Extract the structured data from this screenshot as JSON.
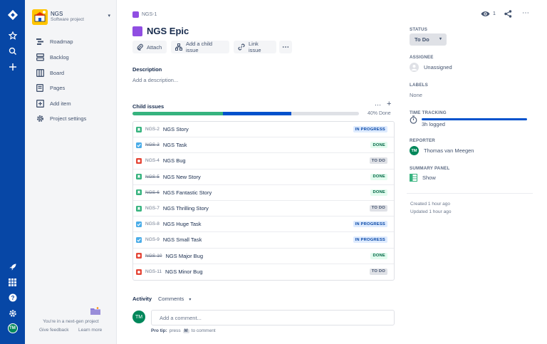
{
  "project": {
    "name": "NGS",
    "type": "Software project"
  },
  "sidebar": {
    "items": [
      {
        "label": "Roadmap",
        "icon": "roadmap-icon"
      },
      {
        "label": "Backlog",
        "icon": "backlog-icon"
      },
      {
        "label": "Board",
        "icon": "board-icon"
      },
      {
        "label": "Pages",
        "icon": "pages-icon"
      },
      {
        "label": "Add item",
        "icon": "add-item-icon"
      },
      {
        "label": "Project settings",
        "icon": "gear-icon"
      }
    ],
    "footer_text": "You're in a next-gen project",
    "give_feedback": "Give feedback",
    "learn_more": "Learn more"
  },
  "global_nav": {
    "user_initials": "TM"
  },
  "issue": {
    "breadcrumb_key": "NGS-1",
    "title": "NGS Epic",
    "watch_count": "1",
    "buttons": {
      "attach": "Attach",
      "add_child": "Add a child issue",
      "link": "Link issue"
    }
  },
  "description": {
    "label": "Description",
    "placeholder": "Add a description..."
  },
  "child_issues": {
    "label": "Child issues",
    "done_fraction": 0.4,
    "in_progress_fraction": 0.3,
    "percent_label": "40% Done",
    "items": [
      {
        "key": "NGS-2",
        "summary": "NGS Story",
        "type": "story",
        "status": "IN PROGRESS",
        "status_kind": "inprog",
        "resolved": false
      },
      {
        "key": "NGS-3",
        "summary": "NGS Task",
        "type": "task",
        "status": "DONE",
        "status_kind": "done",
        "resolved": true
      },
      {
        "key": "NGS-4",
        "summary": "NGS Bug",
        "type": "bug",
        "status": "TO DO",
        "status_kind": "todo",
        "resolved": false
      },
      {
        "key": "NGS-5",
        "summary": "NGS New Story",
        "type": "story",
        "status": "DONE",
        "status_kind": "done",
        "resolved": true
      },
      {
        "key": "NGS-6",
        "summary": "NGS Fantastic Story",
        "type": "story",
        "status": "DONE",
        "status_kind": "done",
        "resolved": true
      },
      {
        "key": "NGS-7",
        "summary": "NGS Thrilling Story",
        "type": "story",
        "status": "TO DO",
        "status_kind": "todo",
        "resolved": false
      },
      {
        "key": "NGS-8",
        "summary": "NGS Huge Task",
        "type": "task",
        "status": "IN PROGRESS",
        "status_kind": "inprog",
        "resolved": false
      },
      {
        "key": "NGS-9",
        "summary": "NGS Small Task",
        "type": "task",
        "status": "IN PROGRESS",
        "status_kind": "inprog",
        "resolved": false
      },
      {
        "key": "NGS-10",
        "summary": "NGS Major Bug",
        "type": "bug",
        "status": "DONE",
        "status_kind": "done",
        "resolved": true
      },
      {
        "key": "NGS-11",
        "summary": "NGS Minor Bug",
        "type": "bug",
        "status": "TO DO",
        "status_kind": "todo",
        "resolved": false
      }
    ]
  },
  "activity": {
    "label": "Activity",
    "filter": "Comments",
    "comment_placeholder": "Add a comment...",
    "protip_label": "Pro tip:",
    "protip_press": "press",
    "protip_key": "M",
    "protip_rest": "to comment",
    "user_initials": "TM"
  },
  "details": {
    "status_label": "STATUS",
    "status_value": "To Do",
    "assignee_label": "ASSIGNEE",
    "assignee_value": "Unassigned",
    "labels_label": "LABELS",
    "labels_value": "None",
    "time_label": "TIME TRACKING",
    "time_value": "3h logged",
    "reporter_label": "REPORTER",
    "reporter_value": "Thomas van Meegen",
    "reporter_initials": "TM",
    "summary_label": "SUMMARY PANEL",
    "summary_value": "Show",
    "created": "Created 1 hour ago",
    "updated": "Updated 1 hour ago"
  },
  "colors": {
    "nav": "#0747a6",
    "epic": "#904ee2",
    "story": "#36b37e",
    "task": "#4bade8",
    "bug": "#e5493a",
    "done_bar": "#36b37e",
    "prog_bar": "#0052cc"
  }
}
